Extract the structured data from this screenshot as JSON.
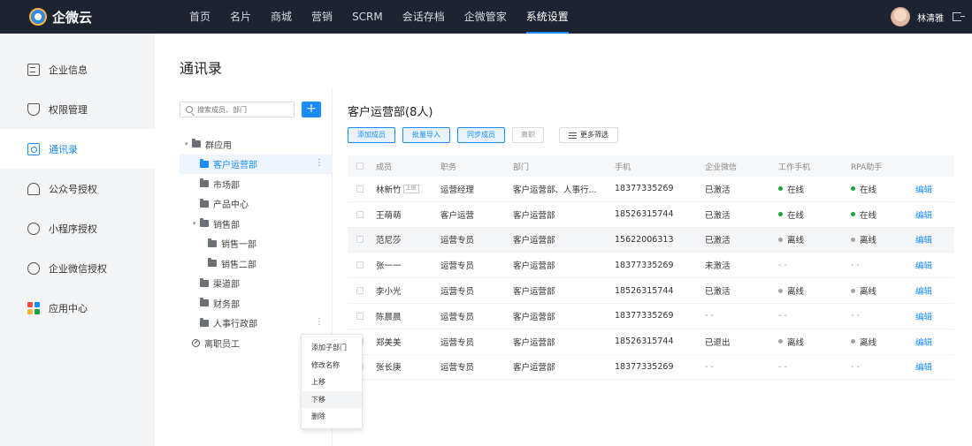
{
  "app": {
    "logo_text": "企微云"
  },
  "nav": {
    "items": [
      "首页",
      "名片",
      "商城",
      "营销",
      "SCRM",
      "会话存档",
      "企微管家",
      "系统设置"
    ],
    "active_index": 7
  },
  "user": {
    "name": "林清雅"
  },
  "sidebar": {
    "items": [
      {
        "label": "企业信息",
        "icon": "document-icon"
      },
      {
        "label": "权限管理",
        "icon": "shield-icon"
      },
      {
        "label": "通讯录",
        "icon": "contacts-icon"
      },
      {
        "label": "公众号授权",
        "icon": "person-icon"
      },
      {
        "label": "小程序授权",
        "icon": "miniprogram-icon"
      },
      {
        "label": "企业微信授权",
        "icon": "chat-icon"
      },
      {
        "label": "应用中心",
        "icon": "apps-icon"
      }
    ],
    "active_index": 2
  },
  "page": {
    "title": "通讯录"
  },
  "dept_panel": {
    "search_placeholder": "搜索成员、部门",
    "add_label": "+",
    "tree": [
      {
        "label": "群应用",
        "level": 0,
        "caret": "▾"
      },
      {
        "label": "客户运营部",
        "level": 1,
        "selected": true,
        "more": true
      },
      {
        "label": "市场部",
        "level": 1
      },
      {
        "label": "产品中心",
        "level": 1
      },
      {
        "label": "销售部",
        "level": 1,
        "caret": "▾"
      },
      {
        "label": "销售一部",
        "level": 2
      },
      {
        "label": "销售二部",
        "level": 2
      },
      {
        "label": "渠道部",
        "level": 1
      },
      {
        "label": "财务部",
        "level": 1
      },
      {
        "label": "人事行政部",
        "level": 1,
        "more": true
      },
      {
        "label": "离职员工",
        "level": 0,
        "icon": "ban"
      }
    ],
    "context_menu": [
      "添加子部门",
      "修改名称",
      "上移",
      "下移",
      "删除"
    ],
    "context_menu_hover_index": 3
  },
  "members": {
    "title": "客户运营部(8人)",
    "toolbar": {
      "add": "添加成员",
      "import": "批量导入",
      "sync": "同步成员",
      "resign": "离职",
      "filter": "更多筛选"
    },
    "columns": [
      "成员",
      "职务",
      "部门",
      "手机",
      "企业微信",
      "工作手机",
      "RPA助手"
    ],
    "status_colors": {
      "online": "#1aa33a",
      "offline": "#a0a4aa"
    },
    "rows": [
      {
        "name": "林新竹",
        "tag": "上级",
        "title": "运营经理",
        "dept": "客户运营部、人事行...",
        "phone": "18377335269",
        "wecom": "已激活",
        "work_phone": "在线",
        "work_phone_status": "online",
        "rpa": "在线",
        "rpa_status": "online",
        "op": "编辑"
      },
      {
        "name": "王萌萌",
        "title": "客户运营",
        "dept": "客户运营部",
        "phone": "18526315744",
        "wecom": "已激活",
        "work_phone": "在线",
        "work_phone_status": "online",
        "rpa": "在线",
        "rpa_status": "online",
        "op": "编辑"
      },
      {
        "name": "范尼莎",
        "title": "运营专员",
        "dept": "客户运营部",
        "phone": "15622006313",
        "wecom": "已激活",
        "work_phone": "离线",
        "work_phone_status": "offline",
        "rpa": "离线",
        "rpa_status": "offline",
        "op": "编辑",
        "highlight": true
      },
      {
        "name": "张一一",
        "title": "运营专员",
        "dept": "客户运营部",
        "phone": "18377335269",
        "wecom": "未激活",
        "work_phone": "- -",
        "work_phone_status": "none",
        "rpa": "- -",
        "rpa_status": "none",
        "op": "编辑"
      },
      {
        "name": "李小光",
        "title": "运营专员",
        "dept": "客户运营部",
        "phone": "18526315744",
        "wecom": "已激活",
        "work_phone": "离线",
        "work_phone_status": "offline",
        "rpa": "离线",
        "rpa_status": "offline",
        "op": "编辑"
      },
      {
        "name": "陈晨晨",
        "title": "运营专员",
        "dept": "客户运营部",
        "phone": "18377335269",
        "wecom": "- -",
        "work_phone": "- -",
        "work_phone_status": "none",
        "rpa": "- -",
        "rpa_status": "none",
        "op": "编辑"
      },
      {
        "name": "郑美美",
        "title": "运营专员",
        "dept": "客户运营部",
        "phone": "18526315744",
        "wecom": "已退出",
        "work_phone": "离线",
        "work_phone_status": "offline",
        "rpa": "离线",
        "rpa_status": "offline",
        "op": "编辑"
      },
      {
        "name": "张长庚",
        "title": "运营专员",
        "dept": "客户运营部",
        "phone": "18377335269",
        "wecom": "- -",
        "work_phone": "- -",
        "work_phone_status": "none",
        "rpa": "- -",
        "rpa_status": "none",
        "op": "编辑"
      }
    ]
  }
}
